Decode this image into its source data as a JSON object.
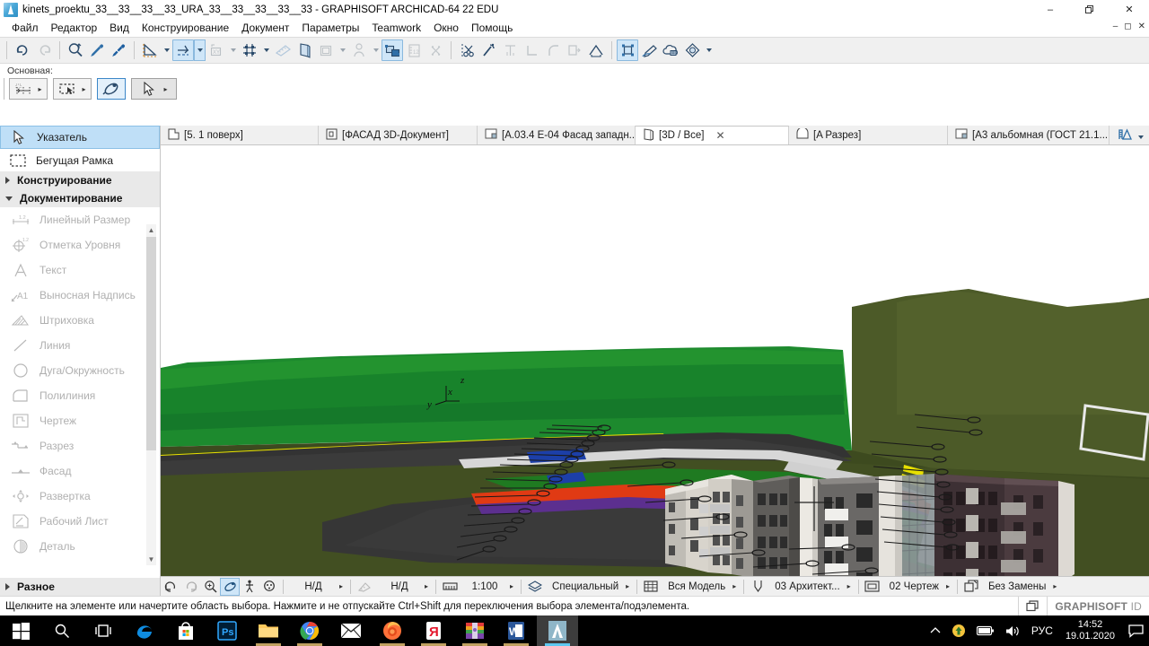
{
  "window": {
    "title": "kinets_proektu_33__33__33__33_URA_33__33__33__33__33 - GRAPHISOFT ARCHICAD-64 22 EDU",
    "app_icon": "archicad-logo-icon",
    "minimize": "–",
    "restore": "❐",
    "close": "✕",
    "doc_minimize": "–",
    "doc_restore": "❐",
    "doc_close": "✕"
  },
  "menu": {
    "items": [
      {
        "label": "Файл"
      },
      {
        "label": "Редактор"
      },
      {
        "label": "Вид"
      },
      {
        "label": "Конструирование"
      },
      {
        "label": "Документ"
      },
      {
        "label": "Параметры"
      },
      {
        "label": "Teamwork"
      },
      {
        "label": "Окно"
      },
      {
        "label": "Помощь"
      }
    ]
  },
  "toolbar": {
    "groups": [
      {
        "buttons": [
          {
            "name": "undo-icon",
            "state": "enabled"
          },
          {
            "name": "redo-icon",
            "state": "disabled"
          }
        ]
      },
      {
        "buttons": [
          {
            "name": "zoom-selection-icon",
            "state": "enabled"
          },
          {
            "name": "eyedropper-pick-icon",
            "state": "enabled"
          },
          {
            "name": "syringe-inject-icon",
            "state": "enabled"
          }
        ]
      },
      {
        "buttons": [
          {
            "name": "guide-lines-icon",
            "state": "enabled",
            "has_arrow": true
          },
          {
            "name": "snap-points-icon",
            "state": "active",
            "has_arrow": true
          },
          {
            "name": "coordinate-origin-icon",
            "state": "disabled",
            "has_arrow": true
          },
          {
            "name": "grid-snap-icon",
            "state": "enabled",
            "has_arrow": true
          },
          {
            "name": "measure-icon",
            "state": "disabled"
          },
          {
            "name": "drafting-plane-icon",
            "state": "enabled"
          },
          {
            "name": "layers-icon",
            "state": "disabled",
            "has_arrow": true
          },
          {
            "name": "pen-set-icon",
            "state": "disabled",
            "has_arrow": true
          },
          {
            "name": "3d-cutaway-icon",
            "state": "active"
          },
          {
            "name": "ruler-12-icon",
            "state": "disabled"
          },
          {
            "name": "marquee-clear-icon",
            "state": "disabled"
          }
        ]
      },
      {
        "buttons": [
          {
            "name": "split-scissors-icon",
            "state": "enabled"
          },
          {
            "name": "magic-wand-icon",
            "state": "enabled"
          },
          {
            "name": "adjust-icon",
            "state": "disabled"
          },
          {
            "name": "trim-corner-icon",
            "state": "disabled"
          },
          {
            "name": "fillet-icon",
            "state": "disabled"
          },
          {
            "name": "offset-icon",
            "state": "disabled"
          },
          {
            "name": "roof-pitch-icon",
            "state": "enabled"
          }
        ]
      },
      {
        "buttons": [
          {
            "name": "marquee-3d-icon",
            "state": "active"
          },
          {
            "name": "edit-3d-icon",
            "state": "enabled"
          },
          {
            "name": "cloud-note-icon",
            "state": "enabled"
          },
          {
            "name": "rendering-icon",
            "state": "enabled",
            "has_arrow": true
          }
        ]
      }
    ]
  },
  "toolbox_strip": {
    "label": "Основная:",
    "tools": [
      {
        "name": "dimension-chain-tool",
        "icon": "dimension-icon",
        "selected": false,
        "has_arrow": true
      },
      {
        "name": "marquee-tool",
        "icon": "marquee-dashed-icon",
        "selected": false,
        "has_arrow": true
      },
      {
        "name": "orbit-tool",
        "icon": "orbit-icon",
        "selected": true,
        "has_arrow": false
      },
      {
        "name": "arrow-tool",
        "icon": "arrow-cursor-icon",
        "selected": false,
        "has_arrow": true
      }
    ]
  },
  "sidebar": {
    "items": [
      {
        "label": "Указатель",
        "icon": "arrow-cursor-icon",
        "active": true
      },
      {
        "label": "Бегущая Рамка",
        "icon": "marquee-dashed-icon",
        "active": false
      }
    ],
    "groups": [
      {
        "label": "Конструирование",
        "expanded": false
      },
      {
        "label": "Документирование",
        "expanded": true
      },
      {
        "label": "Разное",
        "expanded": false
      }
    ],
    "documentation_tools": [
      {
        "label": "Линейный Размер",
        "icon": "linear-dimension-icon"
      },
      {
        "label": "Отметка Уровня",
        "icon": "level-dimension-icon"
      },
      {
        "label": "Текст",
        "icon": "text-icon"
      },
      {
        "label": "Выносная Надпись",
        "icon": "label-a1-icon"
      },
      {
        "label": "Штриховка",
        "icon": "hatch-fill-icon"
      },
      {
        "label": "Линия",
        "icon": "line-icon"
      },
      {
        "label": "Дуга/Окружность",
        "icon": "arc-circle-icon"
      },
      {
        "label": "Полилиния",
        "icon": "polyline-icon"
      },
      {
        "label": "Чертеж",
        "icon": "drawing-icon"
      },
      {
        "label": "Разрез",
        "icon": "section-icon"
      },
      {
        "label": "Фасад",
        "icon": "elevation-icon"
      },
      {
        "label": "Развертка",
        "icon": "interior-elevation-icon"
      },
      {
        "label": "Рабочий Лист",
        "icon": "worksheet-icon"
      },
      {
        "label": "Деталь",
        "icon": "detail-icon"
      }
    ],
    "scroll_up": "▲",
    "scroll_down": "▼"
  },
  "tabs": {
    "items": [
      {
        "label": "[5. 1 поверх]",
        "icon": "floor-plan-icon",
        "active": false,
        "closable": false
      },
      {
        "label": "[ФАСАД 3D-Документ]",
        "icon": "3d-document-icon",
        "active": false,
        "closable": false
      },
      {
        "label": "[A.03.4 E-04 Фасад западн...",
        "icon": "layout-icon",
        "active": false,
        "closable": false
      },
      {
        "label": "[3D / Все]",
        "icon": "3d-view-icon",
        "active": true,
        "closable": true
      },
      {
        "label": "[A Разрез]",
        "icon": "section-view-icon",
        "active": false,
        "closable": false
      },
      {
        "label": "[A3 альбомная (ГОСТ 21.1...",
        "icon": "layout-icon",
        "active": false,
        "closable": false
      }
    ],
    "end_buttons": [
      {
        "name": "view-mode-icon"
      },
      {
        "name": "tab-overflow-chevron-icon"
      }
    ]
  },
  "viewport": {
    "axis_labels": {
      "x": "x",
      "y": "y",
      "z": "z"
    },
    "background": "#ffffff",
    "colors": {
      "ground_far": "#3d4a1f",
      "hill_green": "#4c5a28",
      "terrain_bright": "#1d8a2e",
      "terrain_bright2": "#178a2c",
      "asphalt": "#3b3b3b",
      "asphalt_dark": "#2f2f2f",
      "curb": "#d7d7d7",
      "yellow_line": "#e8e000",
      "lawn": "#1f7a21",
      "facade_light": "#d8d4cc",
      "facade_mid": "#6d6d6d",
      "facade_dark": "#3a2e32",
      "facade_darker": "#4a3e42",
      "glass": "#8d9699",
      "balcony": "#b7b7b7",
      "red_zone": "#e03a14",
      "purple_zone": "#5c2f8f",
      "blue_zone": "#1c3fa8"
    }
  },
  "viewport_bar": {
    "buttons": [
      {
        "name": "pan-back-icon",
        "state": "enabled"
      },
      {
        "name": "pan-forward-icon",
        "state": "disabled"
      },
      {
        "name": "zoom-in-icon",
        "state": "enabled"
      },
      {
        "name": "orbit-icon",
        "state": "active"
      },
      {
        "name": "walk-icon",
        "state": "enabled"
      },
      {
        "name": "fit-in-window-icon",
        "state": "enabled"
      }
    ],
    "fields": [
      {
        "name": "story-field",
        "value": "Н/Д",
        "icon": null,
        "arrow": "▸"
      },
      {
        "name": "renovation-filter-field",
        "value": "Н/Д",
        "icon": "renovation-icon",
        "arrow": "▸"
      },
      {
        "name": "scale-field",
        "value": "1:100",
        "icon": "scale-icon",
        "arrow": "▸"
      },
      {
        "name": "layer-combination-field",
        "value": "Специальный",
        "icon": "layers-icon",
        "arrow": "▸"
      },
      {
        "name": "structure-display-field",
        "value": "Вся Модель",
        "icon": "structure-icon",
        "arrow": "▸"
      },
      {
        "name": "pen-set-field",
        "value": "03 Архитект...",
        "icon": "pen-icon",
        "arrow": "▸"
      },
      {
        "name": "model-view-options-field",
        "value": "02 Чертеж",
        "icon": "mvo-icon",
        "arrow": "▸"
      },
      {
        "name": "graphic-override-field",
        "value": "Без Замены",
        "icon": "override-icon",
        "arrow": "▸"
      }
    ]
  },
  "statusbar": {
    "message": "Щелкните на элементе или начертите область выбора. Нажмите и не отпускайте Ctrl+Shift для переключения выбора элемента/подэлемента.",
    "graphisoft_id": "GRAPHISOFT",
    "graphisoft_id_suffix": "ID",
    "window_icon": "cascade-windows-icon"
  },
  "taskbar": {
    "start": {
      "name": "windows-start-icon"
    },
    "search": {
      "name": "search-icon"
    },
    "taskview": {
      "name": "task-view-icon"
    },
    "apps": [
      {
        "name": "edge-icon",
        "label": "e",
        "state": "pinned"
      },
      {
        "name": "microsoft-store-icon",
        "label": "",
        "state": "pinned"
      },
      {
        "name": "photoshop-icon",
        "label": "Ps",
        "state": "pinned"
      },
      {
        "name": "file-explorer-icon",
        "label": "",
        "state": "open"
      },
      {
        "name": "chrome-icon",
        "label": "",
        "state": "open"
      },
      {
        "name": "mail-icon",
        "label": "",
        "state": "pinned"
      },
      {
        "name": "firefox-icon",
        "label": "",
        "state": "open"
      },
      {
        "name": "yandex-browser-icon",
        "label": "Я",
        "state": "open"
      },
      {
        "name": "winrar-icon",
        "label": "",
        "state": "open"
      },
      {
        "name": "word-icon",
        "label": "W",
        "state": "open"
      },
      {
        "name": "archicad-icon",
        "label": "",
        "state": "active"
      }
    ],
    "tray": {
      "chevron": "⌃",
      "items": [
        {
          "name": "update-icon"
        },
        {
          "name": "battery-icon"
        },
        {
          "name": "volume-icon"
        }
      ],
      "language": "РУС",
      "time": "14:52",
      "date": "19.01.2020",
      "action_center": "notification-icon"
    }
  }
}
